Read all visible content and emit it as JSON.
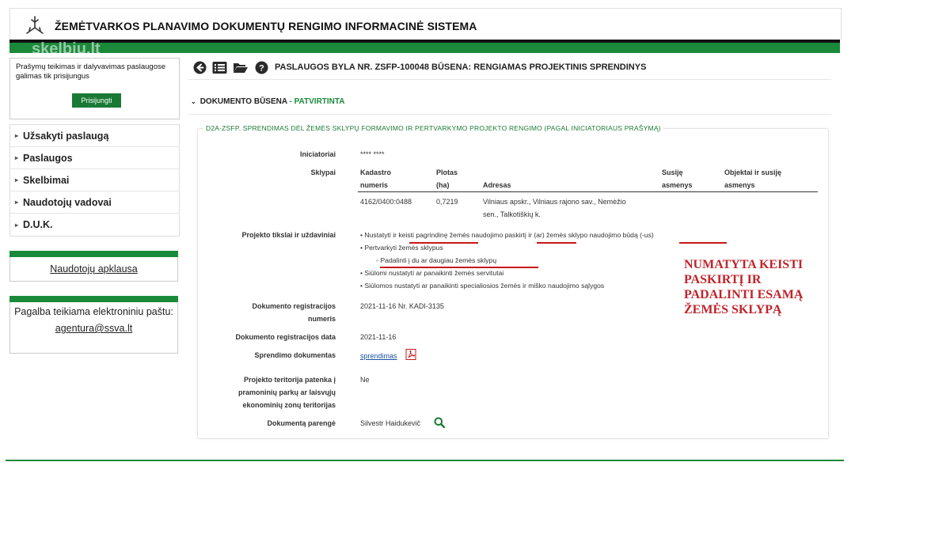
{
  "header": {
    "title": "ŽEMĖTVARKOS PLANAVIMO DOKUMENTŲ RENGIMO INFORMACINĖ SISTEMA",
    "logo_icon": "snowflake-logo-icon",
    "watermark": "skelbiu.lt"
  },
  "sidebar": {
    "login_note": "Prašymų teikimas ir dalyvavimas paslaugose galimas tik prisijungus",
    "login_button": "Prisijungti",
    "menu": [
      {
        "label": "Užsakyti paslaugą"
      },
      {
        "label": "Paslaugos"
      },
      {
        "label": "Skelbimai"
      },
      {
        "label": "Naudotojų vadovai"
      },
      {
        "label": "D.U.K."
      }
    ],
    "survey_link": "Naudotojų apklausa",
    "help_text": "Pagalba teikiama elektroniniu paštu:",
    "help_email": "agentura@ssva.lt"
  },
  "toolbar": {
    "icons": [
      "back-arrow-icon",
      "list-icon",
      "folder-open-icon",
      "help-icon"
    ],
    "case_title": "PASLAUGOS BYLA NR. ZSFP-100048 BŪSENA: RENGIAMAS PROJEKTINIS SPRENDINYS"
  },
  "doc_state": {
    "label": "DOKUMENTO BŪSENA",
    "separator": " - ",
    "value": "PATVIRTINTA"
  },
  "panel": {
    "title": "D2A-ZSFP. SPRENDIMAS DĖL ŽEMĖS SKLYPŲ FORMAVIMO IR PERTVARKYMO PROJEKTO RENGIMO (PAGAL INICIATORIAUS PRAŠYMĄ)",
    "initiator_label": "Iniciatoriai",
    "initiator_value": "**** ****",
    "plots_label": "Sklypai",
    "plots_table": {
      "headers": {
        "cadastre": [
          "Kadastro",
          "numeris"
        ],
        "area": [
          "Plotas",
          "(ha)"
        ],
        "address": "Adresas",
        "related": [
          "Susiję",
          "asmenys"
        ],
        "objects": [
          "Objektai ir susiję",
          "asmenys"
        ]
      },
      "rows": [
        {
          "cadastre": "4162/0400:0488",
          "area": "0,7219",
          "address": [
            "Vilniaus apskr., Vilniaus rajono sav., Nemėžio",
            "sen., Talkotiškių k."
          ],
          "related": "",
          "objects": ""
        }
      ]
    },
    "goals_label": "Projekto tikslai ir uždaviniai",
    "goals": [
      "Nustatyti ir keisti pagrindinę žemės naudojimo paskirtį ir (ar) žemės sklypo naudojimo būdą (-us)",
      "Pertvarkyti žemės sklypus",
      "Padalinti į du ar daugiau žemės sklypų",
      "Siūlomi nustatyti ar panaikinti žemės servitutai",
      "Siūlomos nustatyti ar panaikinti specialiosios žemės ir miško naudojimo sąlygos"
    ],
    "annotation": "NUMATYTA KEISTI\nPASKIRTĮ IR\nPADALINTI ESAMĄ\nŽEMĖS SKLYPĄ",
    "reg_number_label": [
      "Dokumento registracijos",
      "numeris"
    ],
    "reg_number_value": "2021-11-16 Nr. KADI-3135",
    "reg_date_label": "Dokumento registracijos data",
    "reg_date_value": "2021-11-16",
    "decision_doc_label": "Sprendimo dokumentas",
    "decision_doc_link": "sprendimas",
    "industrial_label": [
      "Projekto teritorija patenka į",
      "pramoninių parkų ar laisvųjų",
      "ekonominių zonų teritorijas"
    ],
    "industrial_value": "Ne",
    "prepared_label": "Dokumentą parengė",
    "prepared_value": "Silvestr Haidukevič"
  },
  "colors": {
    "brand_green": "#1a8a3a",
    "dark_green": "#1a7a35",
    "annotation_red": "#c0242a",
    "underline_red": "#c81818"
  }
}
